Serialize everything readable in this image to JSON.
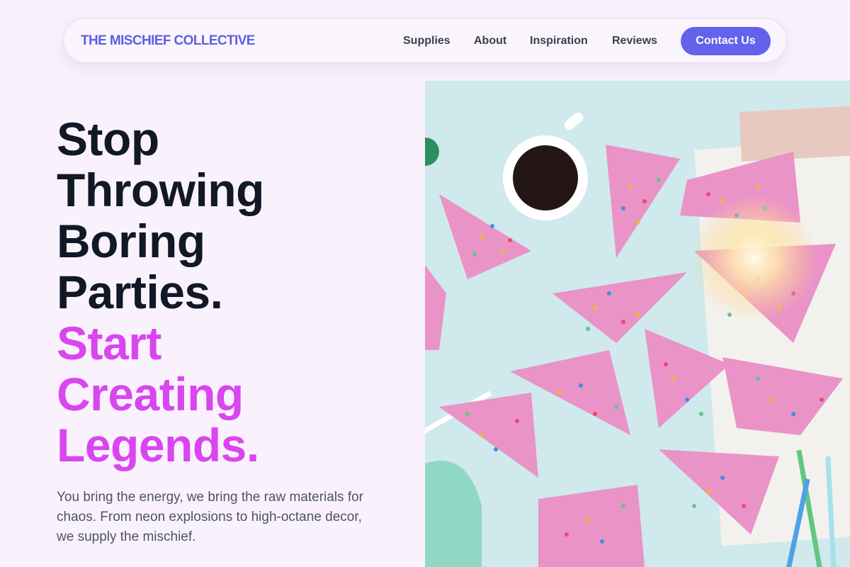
{
  "nav": {
    "brand": "THE MISCHIEF COLLECTIVE",
    "links": [
      "Supplies",
      "About",
      "Inspiration",
      "Reviews"
    ],
    "cta": "Contact Us"
  },
  "hero": {
    "headline_dark": [
      "Stop",
      "Throwing",
      "Boring",
      "Parties."
    ],
    "headline_accent": [
      "Start",
      "Creating",
      "Legends."
    ],
    "subtext": "You bring the energy, we bring the raw materials for chaos. From neon explosions to high-octane decor, we supply the mischief.",
    "image": "party-cake-sprinkles-photo"
  },
  "colors": {
    "brand": "#5f5fe0",
    "cta_bg": "#6262ea",
    "accent": "#d946ef",
    "heading": "#111827",
    "body_text": "#4b5563",
    "page_bg": "#f9f2fd"
  }
}
